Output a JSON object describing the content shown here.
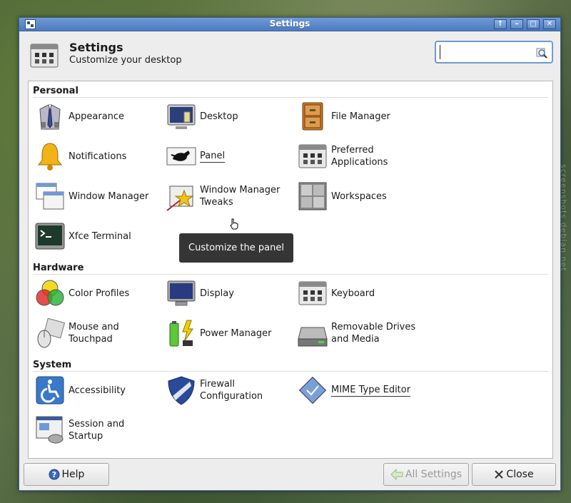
{
  "window": {
    "title": "Settings",
    "buttons": [
      "↑",
      "–",
      "□",
      "✕"
    ]
  },
  "header": {
    "title": "Settings",
    "subtitle": "Customize your desktop"
  },
  "search": {
    "value": "",
    "placeholder": ""
  },
  "sections": {
    "personal": {
      "title": "Personal",
      "items": {
        "appearance": "Appearance",
        "desktop": "Desktop",
        "file_manager": "File Manager",
        "notifications": "Notifications",
        "panel": "Panel",
        "preferred_applications": "Preferred\nApplications",
        "window_manager": "Window Manager",
        "window_manager_tweaks": "Window Manager\nTweaks",
        "workspaces": "Workspaces",
        "xfce_terminal": "Xfce Terminal"
      }
    },
    "hardware": {
      "title": "Hardware",
      "items": {
        "color_profiles": "Color Profiles",
        "display": "Display",
        "keyboard": "Keyboard",
        "mouse_touchpad": "Mouse and\nTouchpad",
        "power_manager": "Power Manager",
        "removable_drives": "Removable Drives\nand Media"
      }
    },
    "system": {
      "title": "System",
      "items": {
        "accessibility": "Accessibility",
        "firewall": "Firewall\nConfiguration",
        "mime_type_editor": "MIME Type Editor",
        "session_startup": "Session and\nStartup"
      }
    }
  },
  "tooltip": "Customize the panel",
  "footer": {
    "help": "Help",
    "all_settings": "All Settings",
    "close": "Close"
  },
  "watermark": "screenshots.debian.net"
}
